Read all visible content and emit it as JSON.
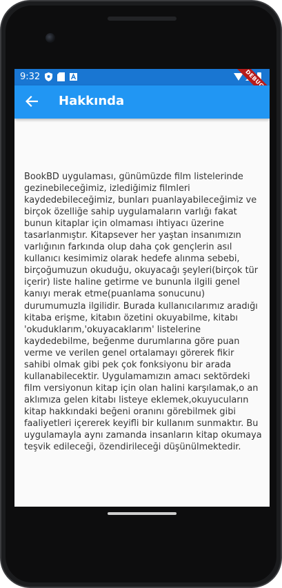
{
  "status_bar": {
    "time": "9:32",
    "icons": [
      "shield-icon",
      "sd-card-icon",
      "a-icon",
      "wifi-icon",
      "signal-icon",
      "battery-icon"
    ],
    "debug_banner": "DEBUG"
  },
  "app_bar": {
    "title": "Hakkında",
    "back_icon": "arrow-left-icon"
  },
  "content": {
    "body": "BookBD uygulaması, günümüzde film listelerinde gezinebileceğimiz, izlediğimiz filmleri kaydedebileceğimiz, bunları puanlayabileceğimiz ve birçok özelliğe sahip uygulamaların varlığı fakat bunun kitaplar için olmaması ihtiyacı üzerine tasarlanmıştır. Kitapsever her yaştan insanımızın varlığının farkında olup daha çok gençlerin asıl kullanıcı kesimimiz olarak hedefe alınma sebebi, birçoğumuzun okuduğu, okuyacağı şeyleri(birçok tür içerir) liste haline getirme ve bununla ilgili genel kanıyı merak etme(puanlama sonucunu) durumumuzla ilgilidir. Burada kullanıcılarımız aradığı kitaba erişme, kitabın özetini okuyabilme, kitabı 'okuduklarım,'okuyacaklarım' listelerine kaydedebilme, beğenme durumlarına göre puan verme ve verilen genel ortalamayı görerek fikir sahibi olmak gibi pek çok fonksiyonu bir arada kullanabilecektir. Uygulamamızın amacı sektördeki film versiyonun kitap için olan halini karşılamak,o an aklımıza gelen kitabı listeye eklemek,okuyucuların kitap hakkındaki beğeni oranını görebilmek gibi faaliyetleri içererek keyifli bir kullanım sunmaktır. Bu uygulamayla aynı zamanda insanların kitap okumaya teşvik edileceği, özendirileceği düşünülmektedir."
  },
  "colors": {
    "status_bar": "#1976d2",
    "app_bar": "#2196f3",
    "background": "#fafafa",
    "text": "#333333"
  }
}
